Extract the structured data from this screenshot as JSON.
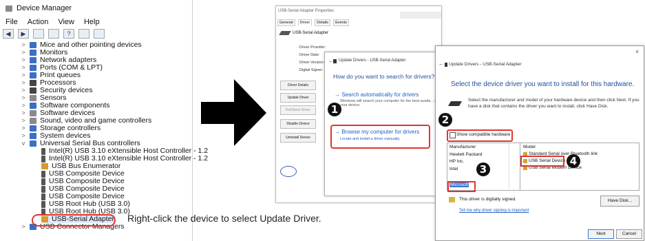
{
  "device_manager": {
    "title": "Device Manager",
    "menu": [
      "File",
      "Action",
      "View",
      "Help"
    ],
    "tree": [
      {
        "label": "Mice and other pointing devices",
        "chev": ">",
        "icon": "mouse-icon"
      },
      {
        "label": "Monitors",
        "chev": ">",
        "icon": "monitor-icon"
      },
      {
        "label": "Network adapters",
        "chev": ">",
        "icon": "network-icon"
      },
      {
        "label": "Ports (COM & LPT)",
        "chev": ">",
        "icon": "port-icon"
      },
      {
        "label": "Print queues",
        "chev": ">",
        "icon": "printer-icon"
      },
      {
        "label": "Processors",
        "chev": ">",
        "icon": "processor-icon"
      },
      {
        "label": "Security devices",
        "chev": ">",
        "icon": "security-icon"
      },
      {
        "label": "Sensors",
        "chev": ">",
        "icon": "sensor-icon"
      },
      {
        "label": "Software components",
        "chev": ">",
        "icon": "software-component-icon"
      },
      {
        "label": "Software devices",
        "chev": ">",
        "icon": "software-device-icon"
      },
      {
        "label": "Sound, video and game controllers",
        "chev": ">",
        "icon": "speaker-icon"
      },
      {
        "label": "Storage controllers",
        "chev": ">",
        "icon": "storage-icon"
      },
      {
        "label": "System devices",
        "chev": ">",
        "icon": "system-icon"
      },
      {
        "label": "Universal Serial Bus controllers",
        "chev": "v",
        "icon": "usb-controller-icon"
      },
      {
        "label": "Intel(R) USB 3.10 eXtensible Host Controller - 1.2",
        "icon": "usb-icon"
      },
      {
        "label": "Intel(R) USB 3.10 eXtensible Host Controller - 1.2",
        "icon": "usb-icon"
      },
      {
        "label": "USB Bus Enumerator",
        "icon": "usb-enumerator-icon"
      },
      {
        "label": "USB Composite Device",
        "icon": "usb-icon"
      },
      {
        "label": "USB Composite Device",
        "icon": "usb-icon"
      },
      {
        "label": "USB Composite Device",
        "icon": "usb-icon"
      },
      {
        "label": "USB Composite Device",
        "icon": "usb-icon"
      },
      {
        "label": "USB Root Hub (USB 3.0)",
        "icon": "usb-icon"
      },
      {
        "label": "USB Root Hub (USB 3.0)",
        "icon": "usb-icon"
      },
      {
        "label": "USB-Serial Adapter",
        "icon": "warning-usb-icon"
      },
      {
        "label": "USB Connector Managers",
        "chev": ">",
        "icon": "usb-connector-icon"
      }
    ]
  },
  "caption": {
    "prefix": "Right-click the device to select ",
    "highlight": "Update Driver",
    "suffix": "."
  },
  "properties_dialog": {
    "title": "USB-Serial Adapter Properties",
    "tabs": [
      "General",
      "Driver",
      "Details",
      "Events"
    ],
    "device_name": "USB-Serial Adapter",
    "fields": [
      "Driver Provider:",
      "Driver Date:",
      "Driver Version:",
      "Digital Signer:"
    ],
    "buttons": [
      "Driver Details",
      "Update Driver",
      "Roll Back Driver",
      "Disable Device",
      "Uninstall Device"
    ]
  },
  "update_dialog_1": {
    "title": "Update Drivers - USB-Serial Adapter",
    "question": "How do you want to search for drivers?",
    "option1": "→ Search automatically for drivers",
    "option1_sub": "Windows will search your computer for the best availa... on your device.",
    "option2": "→ Browse my computer for drivers",
    "option2_sub": "Locate and install a driver manually."
  },
  "update_dialog_2": {
    "title": "Update Drivers - USB-Serial Adapter",
    "close": "×",
    "heading": "Select the device driver you want to install for this hardware.",
    "description": "Select the manufacturer and model of your hardware device and then click Next. If you have a disk that contains the driver you want to install, click Have Disk.",
    "compat_label": "Show compatible hardware",
    "manufacturer_header": "Manufacturer",
    "manufacturers": [
      "Hewlett Packard",
      "HP Inc.",
      "Intel",
      "Microsoft"
    ],
    "model_header": "Model",
    "models": [
      "Standard Serial over Bluetooth link",
      "USB Serial Device",
      "USB Serial Modem Device"
    ],
    "signed": "This driver is digitally signed.",
    "signing_link": "Tell me why driver signing is important",
    "have_disk": "Have Disk...",
    "next": "Next",
    "cancel": "Cancel"
  },
  "steps": [
    "1",
    "2",
    "3",
    "4"
  ],
  "colors": {
    "highlight": "#e0342f",
    "link": "#1f5fbf",
    "heading": "#1f4e9c"
  }
}
